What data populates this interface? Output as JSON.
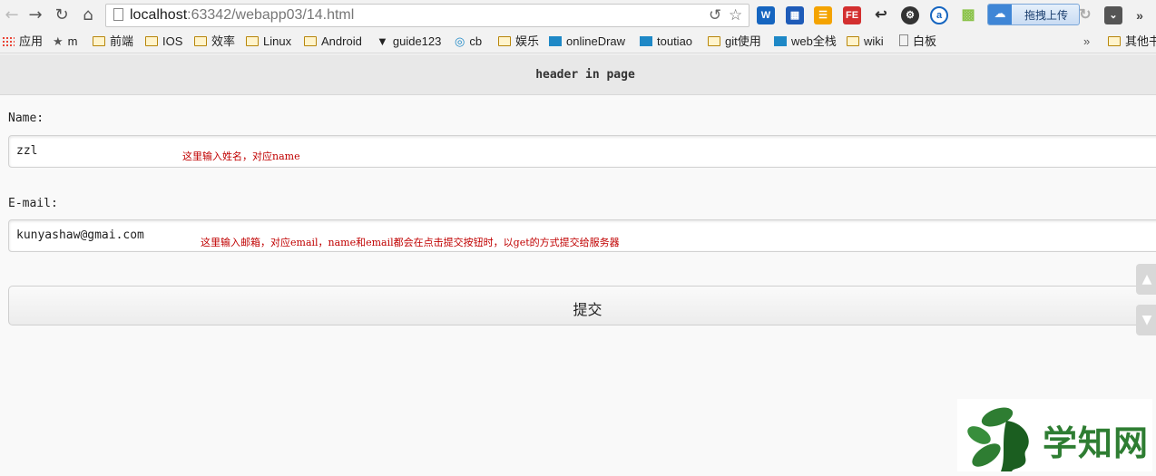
{
  "browser": {
    "url_host": "localhost",
    "url_rest": ":63342/webapp03/14.html",
    "upload_label": "拖拽上传",
    "more_label": "»",
    "bookmarks": [
      {
        "label": "应用",
        "icon": "apps-grid-icon"
      },
      {
        "label": "m",
        "icon": "star-icon"
      },
      {
        "label": "前端",
        "icon": "folder-icon"
      },
      {
        "label": "IOS",
        "icon": "folder-icon"
      },
      {
        "label": "效率",
        "icon": "folder-icon"
      },
      {
        "label": "Linux",
        "icon": "folder-icon"
      },
      {
        "label": "Android",
        "icon": "folder-icon"
      },
      {
        "label": "guide123",
        "icon": "shield-icon"
      },
      {
        "label": "cb",
        "icon": "globe-icon"
      },
      {
        "label": "娱乐",
        "icon": "folder-icon"
      },
      {
        "label": "onlineDraw",
        "icon": "app-icon"
      },
      {
        "label": "toutiao",
        "icon": "app-icon"
      },
      {
        "label": "git使用",
        "icon": "folder-icon"
      },
      {
        "label": "web全栈",
        "icon": "app-icon"
      },
      {
        "label": "wiki",
        "icon": "folder-icon"
      },
      {
        "label": "白板",
        "icon": "page-icon"
      }
    ],
    "bookmarks_overflow": "»",
    "other_bookmarks": "其他书"
  },
  "page": {
    "header": "header in page",
    "name_label": "Name:",
    "name_value": "zzl",
    "name_note": "这里输入姓名，对应name",
    "email_label": "E-mail:",
    "email_value": "kunyashaw@gmai.com",
    "email_note": "这里输入邮箱，对应email，name和email都会在点击提交按钮时，以get的方式提交给服务器",
    "submit_label": "提交"
  },
  "watermark": {
    "text": "学知网"
  },
  "colors": {
    "note": "#c00000",
    "header_bg": "#e8e8e8",
    "watermark": "#2e7d32"
  }
}
